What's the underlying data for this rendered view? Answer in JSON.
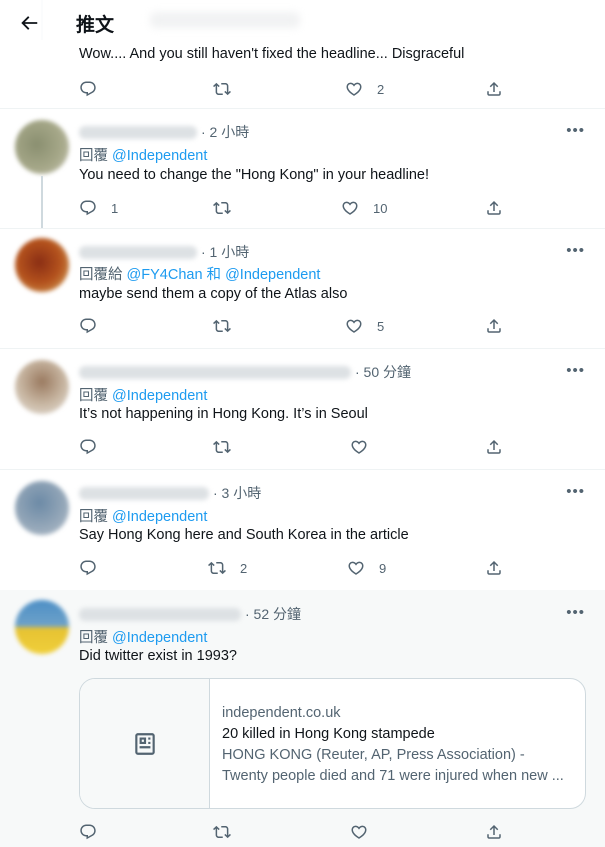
{
  "header": {
    "title": "推文"
  },
  "colors": {
    "link": "#1d9bf0",
    "secondary": "#536471",
    "text": "#0f1419",
    "highlight_bg": "#f7f9f9",
    "border": "#eff3f4"
  },
  "tweets": [
    {
      "text": "Wow.... And you still haven't fixed the headline... Disgraceful",
      "replies": "",
      "retweets": "",
      "likes": "2"
    },
    {
      "time": "· 2 小時",
      "reply_prefix": "回覆 ",
      "reply_handles": "@Independent",
      "text": "You need to change the \"Hong Kong\" in your headline!",
      "replies": "1",
      "retweets": "",
      "likes": "10"
    },
    {
      "time": "· 1 小時",
      "reply_prefix": "回覆給 ",
      "reply_handles": "@FY4Chan 和 @Independent",
      "text": "maybe send them a copy of the Atlas also",
      "replies": "",
      "retweets": "",
      "likes": "5"
    },
    {
      "time": "· 50 分鐘",
      "reply_prefix": "回覆 ",
      "reply_handles": "@Independent",
      "text": "It’s not happening in Hong Kong. It’s in Seoul",
      "replies": "",
      "retweets": "",
      "likes": ""
    },
    {
      "time": "· 3 小時",
      "reply_prefix": "回覆 ",
      "reply_handles": "@Independent",
      "text": "Say Hong Kong here and South Korea in the article",
      "replies": "",
      "retweets": "2",
      "likes": "9"
    },
    {
      "time": "· 52 分鐘",
      "reply_prefix": "回覆 ",
      "reply_handles": "@Independent",
      "text": "Did twitter exist in 1993?",
      "replies": "",
      "retweets": "",
      "likes": "",
      "card": {
        "domain": "independent.co.uk",
        "title": "20 killed in Hong Kong stampede",
        "desc_line1": "HONG KONG (Reuter, AP, Press Association) -",
        "desc_line2": "Twenty people died and 71 were injured when new ..."
      }
    }
  ],
  "more_label": "•••",
  "icons": {
    "back": "arrow-left",
    "reply": "speech-bubble",
    "retweet": "retweet-arrows",
    "like": "heart-outline",
    "share": "share-upload",
    "card": "newspaper"
  }
}
